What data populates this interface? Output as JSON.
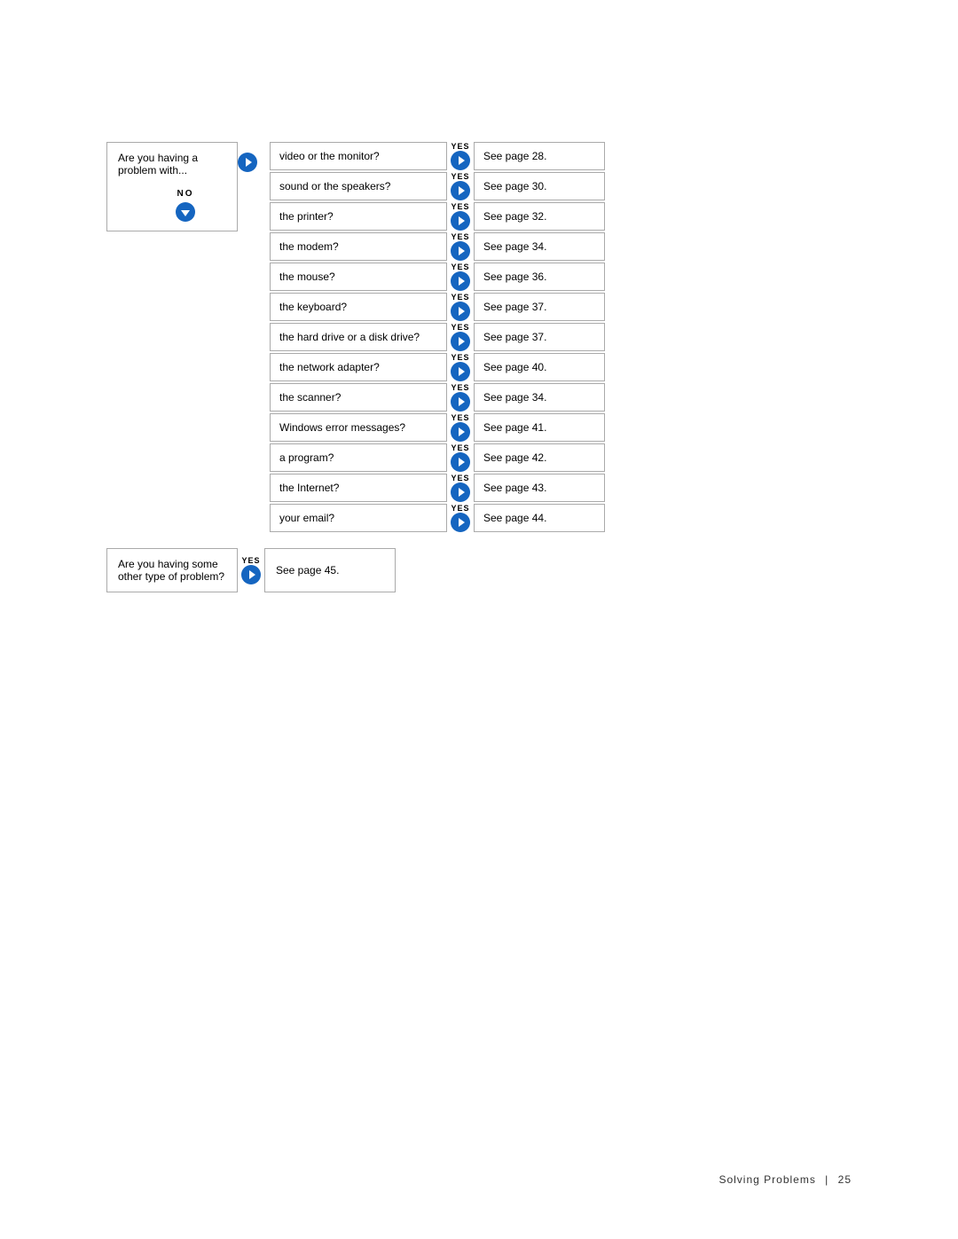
{
  "header": {},
  "main": {
    "left_box_text": "Are you having a problem with...",
    "no_label": "NO",
    "items": [
      {
        "question": "video or the monitor?",
        "yes_label": "YES",
        "result": "See page 28."
      },
      {
        "question": "sound or the speakers?",
        "yes_label": "YES",
        "result": "See page 30."
      },
      {
        "question": "the printer?",
        "yes_label": "YES",
        "result": "See page 32."
      },
      {
        "question": "the modem?",
        "yes_label": "YES",
        "result": "See page 34."
      },
      {
        "question": "the mouse?",
        "yes_label": "YES",
        "result": "See page 36."
      },
      {
        "question": "the keyboard?",
        "yes_label": "YES",
        "result": "See page 37."
      },
      {
        "question": "the hard drive or a disk drive?",
        "yes_label": "YES",
        "result": "See page 37."
      },
      {
        "question": "the network adapter?",
        "yes_label": "YES",
        "result": "See page 40."
      },
      {
        "question": "the scanner?",
        "yes_label": "YES",
        "result": "See page 34."
      },
      {
        "question": "Windows error messages?",
        "yes_label": "YES",
        "result": "See page 41."
      },
      {
        "question": "a program?",
        "yes_label": "YES",
        "result": "See page 42."
      },
      {
        "question": "the Internet?",
        "yes_label": "YES",
        "result": "See page 43."
      },
      {
        "question": "your email?",
        "yes_label": "YES",
        "result": "See page 44."
      }
    ],
    "bottom": {
      "left_box_text": "Are you having some other type of problem?",
      "yes_label": "YES",
      "result": "See page 45."
    }
  },
  "footer": {
    "text": "Solving Problems",
    "pipe": "|",
    "page_number": "25"
  }
}
